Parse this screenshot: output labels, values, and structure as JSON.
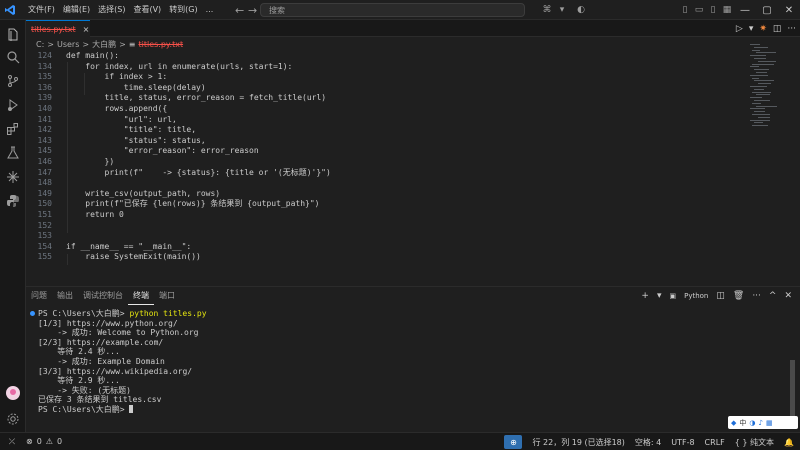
{
  "menu": [
    "文件(F)",
    "编辑(E)",
    "选择(S)",
    "查看(V)",
    "转到(G)",
    "..."
  ],
  "search": {
    "placeholder": "搜索"
  },
  "tab": {
    "label": "titles.py.txt"
  },
  "breadcrumb": {
    "drive": "C:",
    "sep": ">",
    "users": "Users",
    "user": "大白鹏",
    "file": "titles.py.txt"
  },
  "code": [
    {
      "n": "124",
      "t": "def main():"
    },
    {
      "n": "134",
      "t": "    for index, url in enumerate(urls, start=1):"
    },
    {
      "n": "135",
      "t": "        if index > 1:"
    },
    {
      "n": "136",
      "t": "            time.sleep(delay)"
    },
    {
      "n": "139",
      "t": "        title, status, error_reason = fetch_title(url)"
    },
    {
      "n": "140",
      "t": "        rows.append({"
    },
    {
      "n": "141",
      "t": "            \"url\": url,"
    },
    {
      "n": "142",
      "t": "            \"title\": title,"
    },
    {
      "n": "143",
      "t": "            \"status\": status,"
    },
    {
      "n": "145",
      "t": "            \"error_reason\": error_reason"
    },
    {
      "n": "146",
      "t": "        })"
    },
    {
      "n": "147",
      "t": "        print(f\"    -> {status}: {title or '(无标题)'}\")"
    },
    {
      "n": "148",
      "t": ""
    },
    {
      "n": "149",
      "t": "    write_csv(output_path, rows)"
    },
    {
      "n": "150",
      "t": "    print(f\"已保存 {len(rows)} 条结果到 {output_path}\")"
    },
    {
      "n": "151",
      "t": "    return 0"
    },
    {
      "n": "152",
      "t": ""
    },
    {
      "n": "153",
      "t": ""
    },
    {
      "n": "154",
      "t": "if __name__ == \"__main__\":"
    },
    {
      "n": "155",
      "t": "    raise SystemExit(main())"
    }
  ],
  "panel": {
    "tabs": [
      "问题",
      "输出",
      "调试控制台",
      "终端",
      "端口"
    ],
    "active_tab": "终端",
    "shell": "Python"
  },
  "terminal": {
    "prompt": "PS C:\\Users\\大白鹏>",
    "command": "python titles.py",
    "lines": [
      "[1/3] https://www.python.org/",
      "    -> 成功: Welcome to Python.org",
      "[2/3] https://example.com/",
      "    等待 2.4 秒...",
      "    -> 成功: Example Domain",
      "[3/3] https://www.wikipedia.org/",
      "    等待 2.9 秒...",
      "    -> 失败: (无标题)",
      "已保存 3 条结果到 titles.csv"
    ],
    "final_prompt": "PS C:\\Users\\大白鹏>"
  },
  "ime": {
    "lang": "中"
  },
  "status": {
    "errors": "0",
    "warnings": "0",
    "position": "行 22，列 19 (已选择18)",
    "spaces": "空格: 4",
    "encoding": "UTF-8",
    "eol": "CRLF",
    "language": "纯文本",
    "language_braces": "{ }"
  },
  "colors": {
    "accent": "#0078d4",
    "deleted_file": "#f85149",
    "terminal_dot": "#3794ff"
  }
}
